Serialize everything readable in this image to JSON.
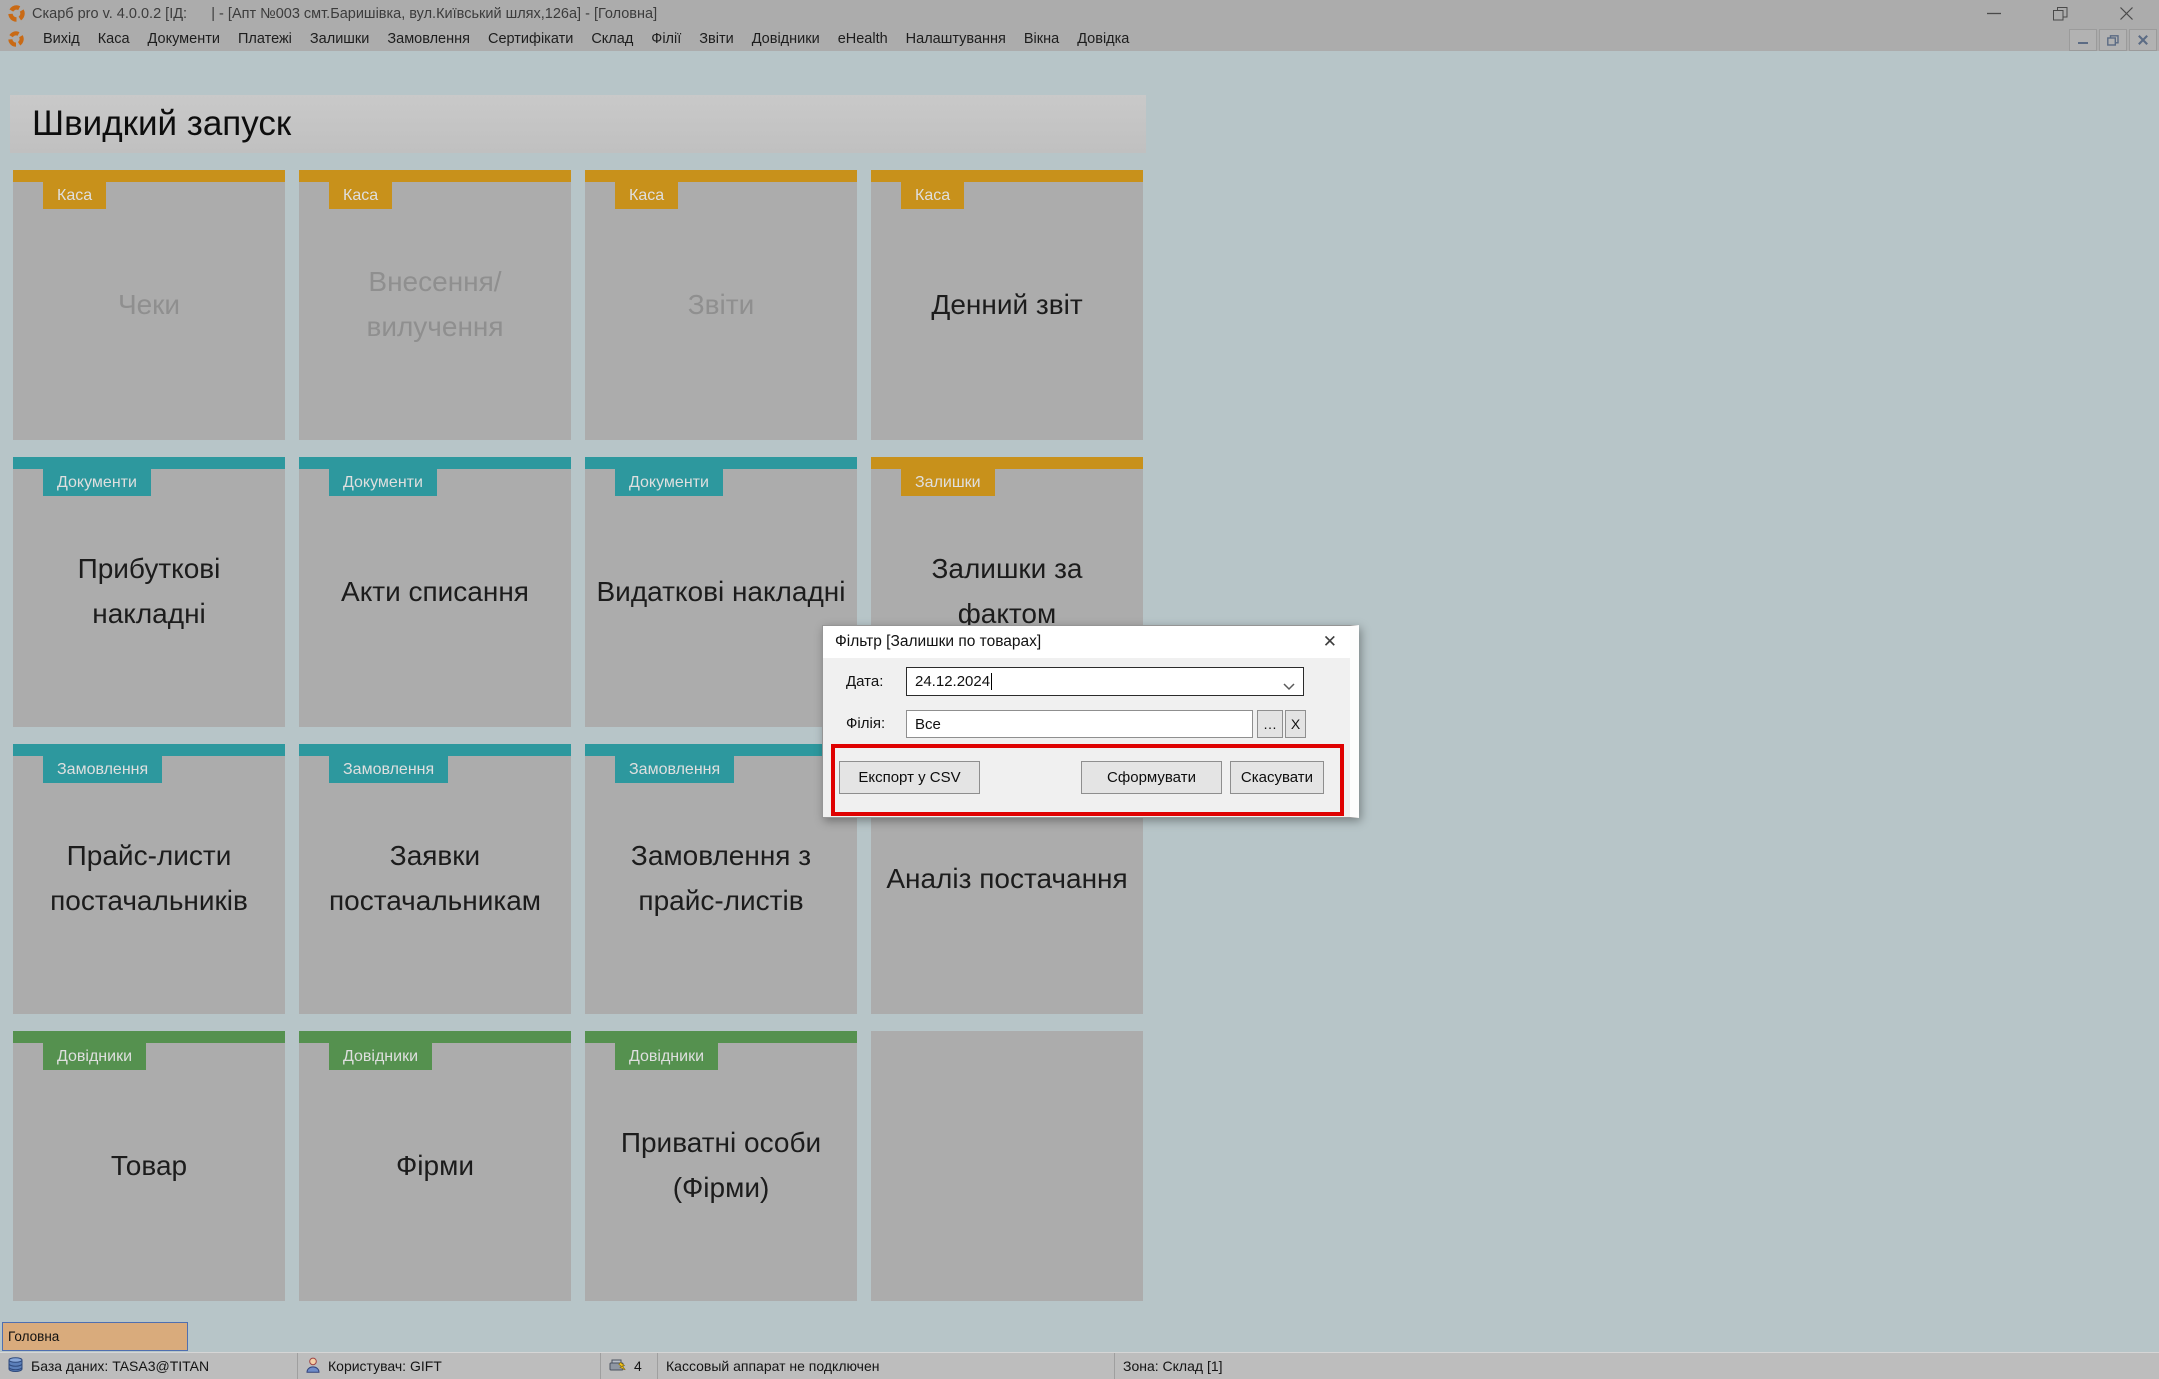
{
  "window": {
    "title": "Скарб pro v. 4.0.0.2 [ІД:      | - [Апт №003 смт.Баришівка, вул.Київський шлях,126а] - [Головна]",
    "controls": {
      "minimize": "minimize",
      "restore": "restore",
      "close": "close"
    }
  },
  "menu": {
    "items": [
      "Вихід",
      "Каса",
      "Документи",
      "Платежі",
      "Залишки",
      "Замовлення",
      "Сертифікати",
      "Склад",
      "Філії",
      "Звіти",
      "Довідники",
      "eHealth",
      "Налаштування",
      "Вікна",
      "Довідка"
    ]
  },
  "quick_launch": {
    "title": "Швидкий запуск",
    "category_colors": {
      "Каса": "#c8911b",
      "Документи": "#2d989e",
      "Залишки": "#c8911b",
      "Замовлення": "#2d989e",
      "Довідники": "#55914f"
    },
    "tiles": [
      {
        "category": "Каса",
        "label": "Чеки",
        "disabled": true
      },
      {
        "category": "Каса",
        "label": "Внесення/вилучення",
        "disabled": true
      },
      {
        "category": "Каса",
        "label": "Звіти",
        "disabled": true
      },
      {
        "category": "Каса",
        "label": "Денний звіт",
        "disabled": false
      },
      {
        "category": "Документи",
        "label": "Прибуткові накладні",
        "disabled": false
      },
      {
        "category": "Документи",
        "label": "Акти списання",
        "disabled": false
      },
      {
        "category": "Документи",
        "label": "Видаткові накладні",
        "disabled": false
      },
      {
        "category": "Залишки",
        "label": "Залишки за фактом",
        "disabled": false
      },
      {
        "category": "Замовлення",
        "label": "Прайс-листи постачальників",
        "disabled": false
      },
      {
        "category": "Замовлення",
        "label": "Заявки постачальникам",
        "disabled": false
      },
      {
        "category": "Замовлення",
        "label": "Замовлення з прайс-листів",
        "disabled": false
      },
      {
        "category": "Замовлення",
        "label": "Аналіз постачання",
        "disabled": false
      },
      {
        "category": "Довідники",
        "label": "Товар",
        "disabled": false
      },
      {
        "category": "Довідники",
        "label": "Фірми",
        "disabled": false
      },
      {
        "category": "Довідники",
        "label": "Приватні особи (Фірми)",
        "disabled": false
      },
      {
        "empty": true
      }
    ]
  },
  "dialog": {
    "title": "Фільтр [Залишки по товарах]",
    "close_icon": "✕",
    "date_label": "Дата:",
    "date_value": "24.12.2024",
    "branch_label": "Філія:",
    "branch_value": "Все",
    "browse_button": "…",
    "clear_button": "X",
    "buttons": {
      "export": "Експорт у CSV",
      "generate": "Сформувати",
      "cancel": "Скасувати"
    },
    "highlight_color": "#df0101"
  },
  "bottom": {
    "tab_label": "Головна",
    "status": {
      "database": "База даних: TASA3@TITAN",
      "user": "Користувач: GIFT",
      "register_count": "4",
      "register_message": "Кассовый аппарат не подключен",
      "zone": "Зона: Склад [1]"
    }
  },
  "icons": {
    "app_logo": "orange segmented C gear",
    "database": "database-icon",
    "user": "person-icon",
    "register": "cash-register-lightning-icon",
    "combo_chevron": "chevron-down-icon"
  },
  "colors": {
    "titlebar": "#acacac",
    "client_background": "#b7c5c8",
    "tile_body": "#acacac",
    "gold": "#c8911b",
    "teal": "#2d989e",
    "green": "#55914f",
    "highlight_red": "#df0101",
    "tab_fill": "#d9ab7c",
    "tab_border": "#4f6fb0",
    "logo_orange": "#c96a15"
  }
}
